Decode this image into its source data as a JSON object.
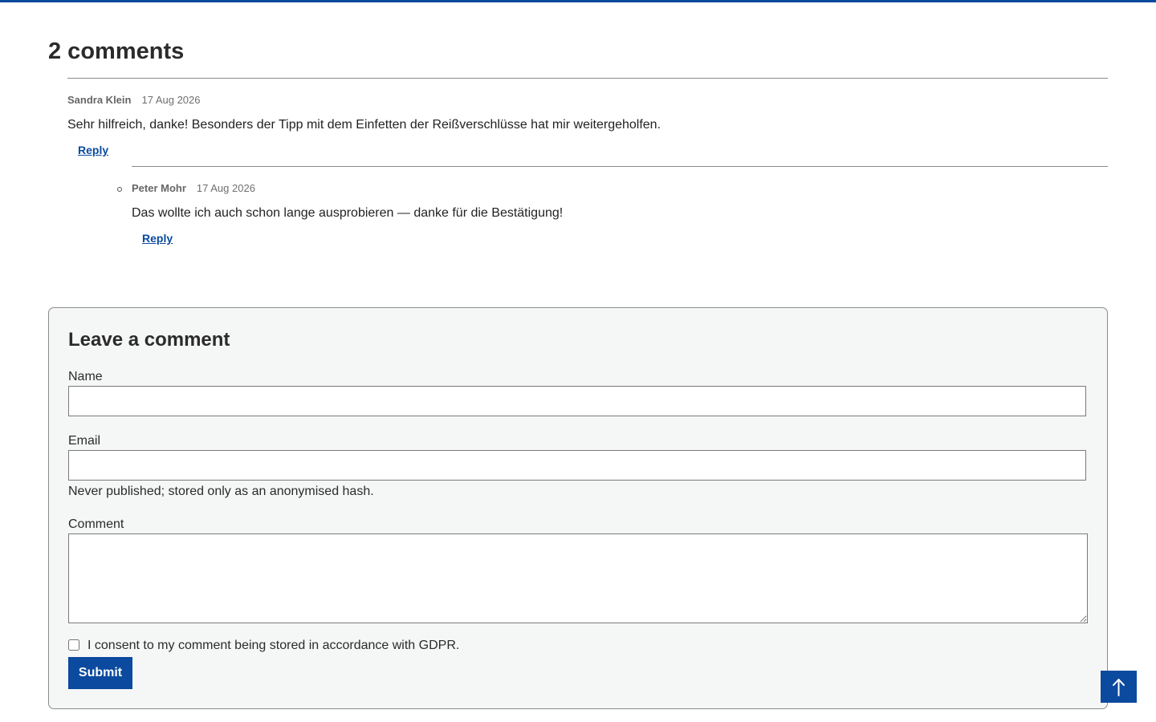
{
  "comments_section": {
    "title": "2 comments",
    "comments": [
      {
        "author": "Sandra Klein",
        "date": "17 Aug 2026",
        "text": "Sehr hilfreich, danke! Besonders der Tipp mit dem Einfetten der Reißverschlüsse hat mir weitergeholfen.",
        "reply_label": "Reply"
      },
      {
        "author": "Peter Mohr",
        "date": "17 Aug 2026",
        "text": "Das wollte ich auch schon lange ausprobieren — danke für die Bestätigung!",
        "reply_label": "Reply"
      }
    ]
  },
  "comment_form": {
    "title": "Leave a comment",
    "name_label": "Name",
    "name_value": "",
    "email_label": "Email",
    "email_value": "",
    "email_help": "Never published; stored only as an anonymised hash.",
    "comment_label": "Comment",
    "comment_value": "",
    "consent_label": "I consent to my comment being stored in accordance with GDPR.",
    "consent_checked": false,
    "submit_label": "Submit"
  },
  "back_to_top": {
    "icon": "arrow-up-icon"
  },
  "colors": {
    "accent": "#0b4a9e",
    "form_background": "#f5f6f6",
    "divider": "#8a8a8a"
  }
}
